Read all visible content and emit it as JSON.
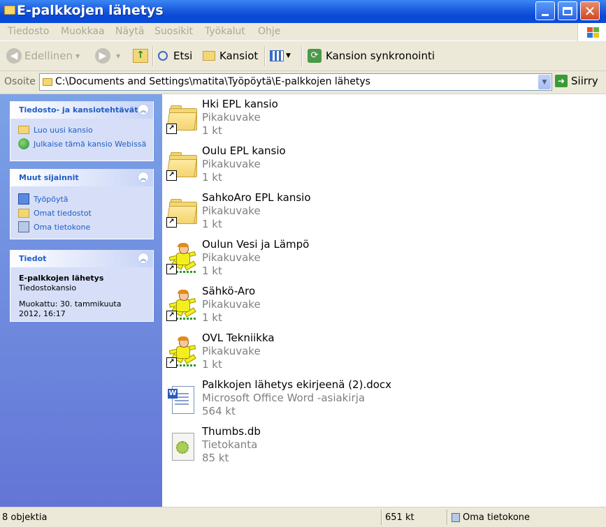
{
  "window": {
    "title": "E-palkkojen lähetys"
  },
  "menu": [
    "Tiedosto",
    "Muokkaa",
    "Näytä",
    "Suosikit",
    "Työkalut",
    "Ohje"
  ],
  "toolbar": {
    "back": "Edellinen",
    "search": "Etsi",
    "folders": "Kansiot",
    "sync": "Kansion synkronointi"
  },
  "address": {
    "label": "Osoite",
    "path": "C:\\Documents and Settings\\matita\\Työpöytä\\E-palkkojen lähetys",
    "go": "Siirry"
  },
  "sidebar": {
    "tasks": {
      "title": "Tiedosto- ja kansiotehtävät",
      "links": [
        "Luo uusi kansio",
        "Julkaise tämä kansio Webissä"
      ]
    },
    "places": {
      "title": "Muut sijainnit",
      "links": [
        "Työpöytä",
        "Omat tiedostot",
        "Oma tietokone"
      ]
    },
    "details": {
      "title": "Tiedot",
      "name": "E-palkkojen lähetys",
      "type": "Tiedostokansio",
      "modified": "Muokattu: 30. tammikuuta 2012, 16:17"
    }
  },
  "files": [
    {
      "name": "Hki EPL kansio",
      "type": "Pikakuvake",
      "size": "1 kt",
      "icon": "folder-shortcut-icon"
    },
    {
      "name": "Oulu EPL kansio",
      "type": "Pikakuvake",
      "size": "1 kt",
      "icon": "folder-shortcut-icon"
    },
    {
      "name": "SahkoAro EPL kansio",
      "type": "Pikakuvake",
      "size": "1 kt",
      "icon": "folder-shortcut-icon"
    },
    {
      "name": "Oulun Vesi ja Lämpö",
      "type": "Pikakuvake",
      "size": "1 kt",
      "icon": "runner-shortcut-icon"
    },
    {
      "name": "Sähkö-Aro",
      "type": "Pikakuvake",
      "size": "1 kt",
      "icon": "runner-shortcut-icon"
    },
    {
      "name": "OVL Tekniikka",
      "type": "Pikakuvake",
      "size": "1 kt",
      "icon": "runner-shortcut-icon"
    },
    {
      "name": "Palkkojen lähetys ekirjeenä (2).docx",
      "type": "Microsoft Office Word -asiakirja",
      "size": "564 kt",
      "icon": "word-document-icon"
    },
    {
      "name": "Thumbs.db",
      "type": "Tietokanta",
      "size": "85 kt",
      "icon": "database-file-icon"
    }
  ],
  "status": {
    "count": "8 objektia",
    "size": "651 kt",
    "location": "Oma tietokone"
  }
}
